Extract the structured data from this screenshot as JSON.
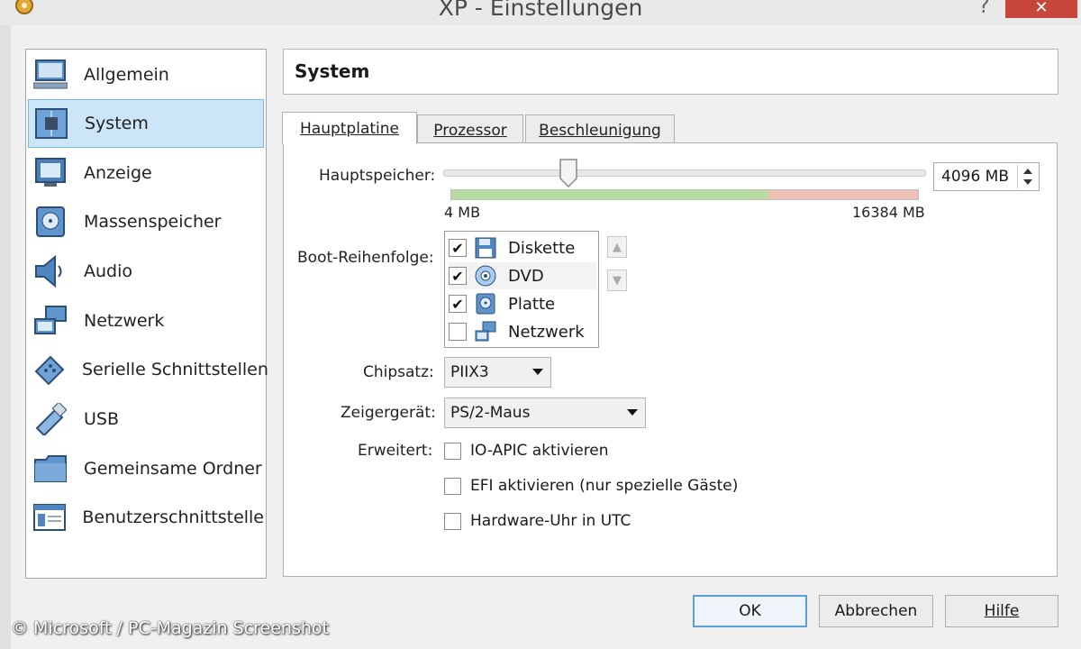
{
  "window": {
    "title": "XP - Einstellungen",
    "help_glyph": "?",
    "close_glyph": "✕"
  },
  "sidebar": {
    "items": [
      {
        "label": "Allgemein",
        "icon": "monitor-icon"
      },
      {
        "label": "System",
        "icon": "chip-icon"
      },
      {
        "label": "Anzeige",
        "icon": "display-icon"
      },
      {
        "label": "Massenspeicher",
        "icon": "disk-icon"
      },
      {
        "label": "Audio",
        "icon": "speaker-icon"
      },
      {
        "label": "Netzwerk",
        "icon": "network-icon"
      },
      {
        "label": "Serielle Schnittstellen",
        "icon": "serial-icon"
      },
      {
        "label": "USB",
        "icon": "usb-icon"
      },
      {
        "label": "Gemeinsame Ordner",
        "icon": "folder-icon"
      },
      {
        "label": "Benutzerschnittstelle",
        "icon": "ui-icon"
      }
    ],
    "selected": "System"
  },
  "header": {
    "title": "System"
  },
  "tabs": [
    {
      "label": "Hauptplatine",
      "active": true
    },
    {
      "label": "Prozessor",
      "active": false
    },
    {
      "label": "Beschleunigung",
      "active": false
    }
  ],
  "memory": {
    "label": "Hauptspeicher:",
    "value": "4096 MB",
    "min_label": "4 MB",
    "max_label": "16384 MB",
    "slider_fraction": 0.25,
    "colors": {
      "safe": "#b7dca0",
      "risky": "#f0c0b4"
    }
  },
  "boot": {
    "label": "Boot-Reihenfolge:",
    "items": [
      {
        "label": "Diskette",
        "checked": true,
        "icon": "floppy-icon"
      },
      {
        "label": "DVD",
        "checked": true,
        "icon": "dvd-icon"
      },
      {
        "label": "Platte",
        "checked": true,
        "icon": "harddisk-icon"
      },
      {
        "label": "Netzwerk",
        "checked": false,
        "icon": "network-icon"
      }
    ]
  },
  "chipset": {
    "label": "Chipsatz:",
    "value": "PIIX3"
  },
  "pointer": {
    "label": "Zeigergerät:",
    "value": "PS/2-Maus"
  },
  "extended": {
    "label": "Erweitert:",
    "options": [
      {
        "label": "IO-APIC aktivieren",
        "checked": false
      },
      {
        "label": "EFI aktivieren (nur spezielle Gäste)",
        "checked": false
      },
      {
        "label": "Hardware-Uhr in UTC",
        "checked": false
      }
    ]
  },
  "buttons": {
    "ok": "OK",
    "cancel": "Abbrechen",
    "help": "Hilfe"
  },
  "watermark": "© Microsoft / PC-Magazin Screenshot"
}
